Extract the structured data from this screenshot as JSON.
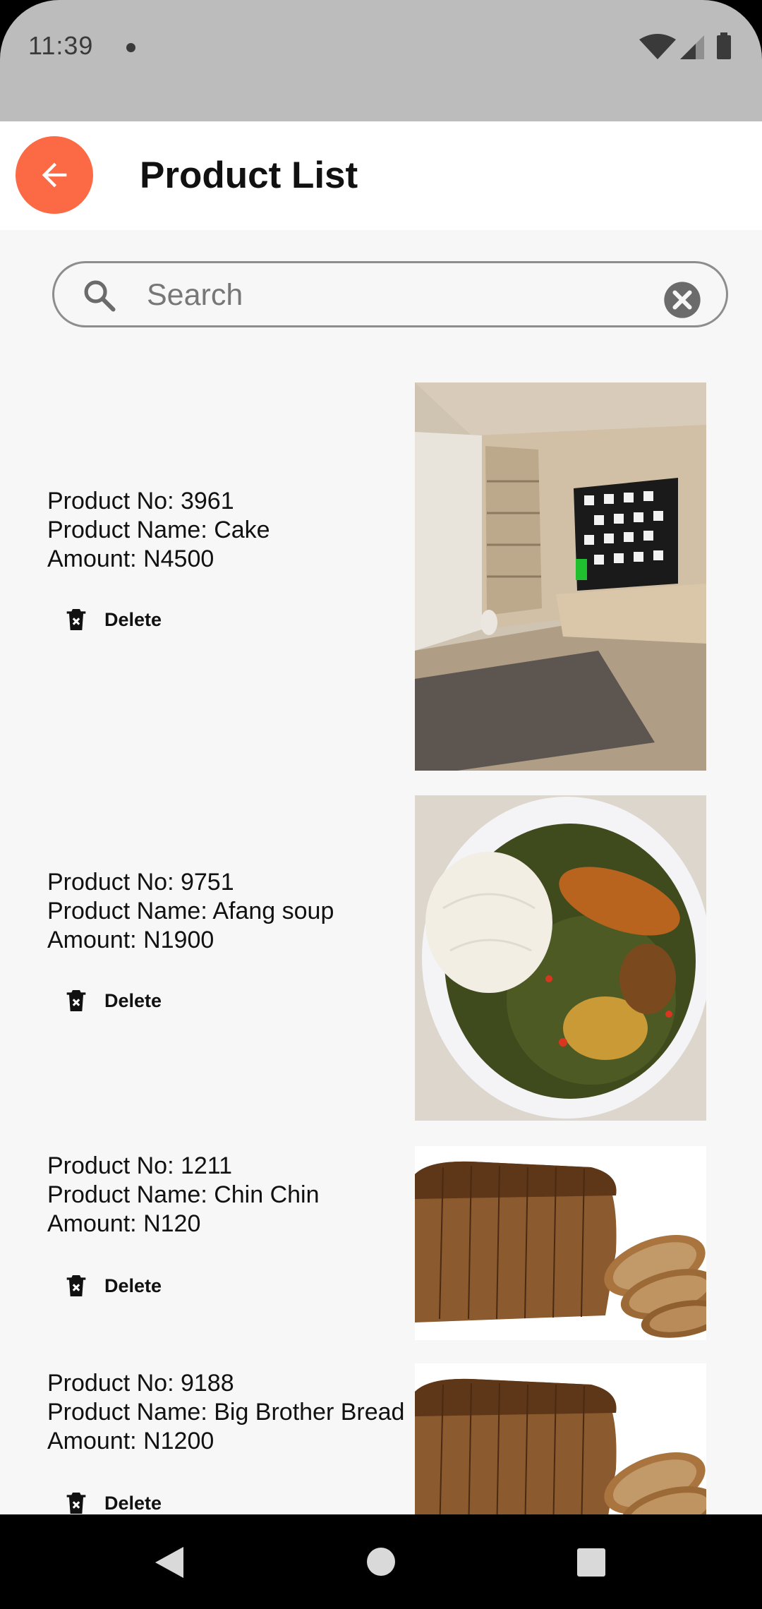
{
  "status_bar": {
    "time": "11:39"
  },
  "header": {
    "title": "Product List",
    "back_icon": "arrow-left-icon",
    "accent_color": "#fb6a44"
  },
  "search": {
    "placeholder": "Search",
    "value": ""
  },
  "products": [
    {
      "number_line": "Product No: 3961",
      "name_line": "Product Name: Cake",
      "amount_line": "Amount: N4500",
      "delete_label": "Delete",
      "image_subject": "room-with-tv"
    },
    {
      "number_line": "Product No: 9751",
      "name_line": "Product Name: Afang soup",
      "amount_line": "Amount: N1900",
      "delete_label": "Delete",
      "image_subject": "plate-of-afang-soup"
    },
    {
      "number_line": "Product No: 1211",
      "name_line": "Product Name: Chin Chin",
      "amount_line": "Amount: N120",
      "delete_label": "Delete",
      "image_subject": "sliced-bread-loaf"
    },
    {
      "number_line": "Product No: 9188",
      "name_line": "Product Name: Big Brother Bread",
      "amount_line": "Amount: N1200",
      "delete_label": "Delete",
      "image_subject": "sliced-bread-loaf"
    }
  ]
}
